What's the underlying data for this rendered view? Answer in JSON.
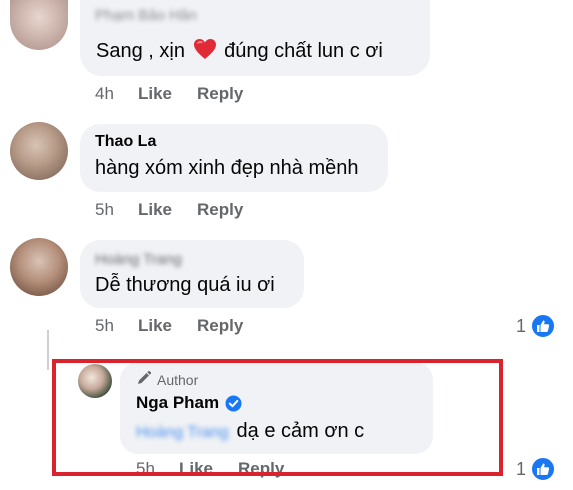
{
  "colors": {
    "accent_blue": "#1877f2",
    "bubble_bg": "#f0f2f5",
    "meta_grey": "#65676b",
    "highlight_red": "#d9232d"
  },
  "comments": [
    {
      "author": "Phạm Bảo Hân",
      "text_before_emoji": "Sang , xịn",
      "emoji": "red-heart-icon",
      "text_after_emoji": "đúng chất lun c ơi",
      "time": "4h",
      "like_label": "Like",
      "reply_label": "Reply"
    },
    {
      "author": "Thao La",
      "text": "hàng xóm xinh đẹp nhà mềnh",
      "time": "5h",
      "like_label": "Like",
      "reply_label": "Reply"
    },
    {
      "author": "Hoàng Trang",
      "text": "Dễ thương quá iu ơi",
      "time": "5h",
      "like_label": "Like",
      "reply_label": "Reply",
      "reaction_count": "1"
    }
  ],
  "reply": {
    "badge": "Author",
    "author": "Nga Pham",
    "tag": "Hoàng Trang",
    "text": "dạ e cảm ơn c",
    "time": "5h",
    "like_label": "Like",
    "reply_label": "Reply",
    "reaction_count": "1"
  }
}
